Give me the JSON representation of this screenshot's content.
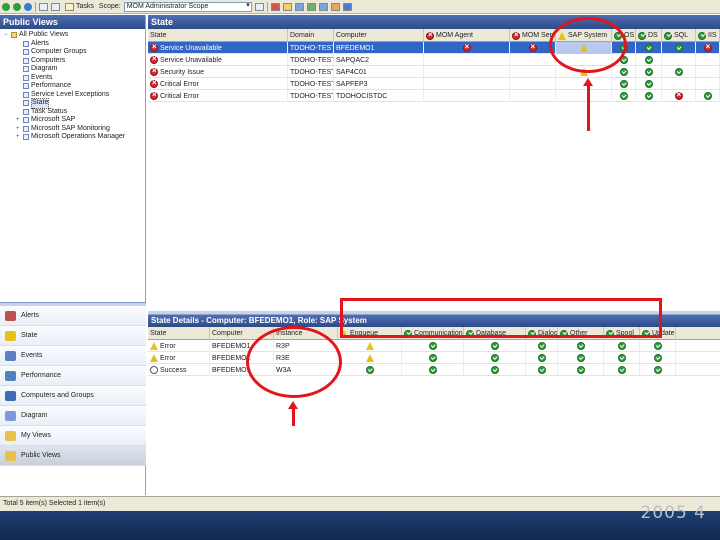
{
  "toolbar": {
    "tasks_label": "Tasks",
    "scope_label": "Scope:",
    "scope_value": "MOM Administrator Scope"
  },
  "left_pane": {
    "title": "Public Views",
    "tree": [
      {
        "label": "All Public Views",
        "depth": 0,
        "exp": "−"
      },
      {
        "label": "Alerts",
        "depth": 1,
        "exp": ""
      },
      {
        "label": "Computer Groups",
        "depth": 1,
        "exp": ""
      },
      {
        "label": "Computers",
        "depth": 1,
        "exp": ""
      },
      {
        "label": "Diagram",
        "depth": 1,
        "exp": ""
      },
      {
        "label": "Events",
        "depth": 1,
        "exp": ""
      },
      {
        "label": "Performance",
        "depth": 1,
        "exp": ""
      },
      {
        "label": "Service Level Exceptions",
        "depth": 1,
        "exp": ""
      },
      {
        "label": "State",
        "depth": 1,
        "exp": "",
        "selected": true
      },
      {
        "label": "Task Status",
        "depth": 1,
        "exp": ""
      },
      {
        "label": "Microsoft SAP",
        "depth": 1,
        "exp": "+"
      },
      {
        "label": "Microsoft SAP Monitoring",
        "depth": 1,
        "exp": "+"
      },
      {
        "label": "Microsoft Operations Manager",
        "depth": 1,
        "exp": "+"
      }
    ],
    "wunderbar": [
      {
        "label": "Alerts",
        "color": "#c0504d"
      },
      {
        "label": "State",
        "color": "#e6c217"
      },
      {
        "label": "Events",
        "color": "#5b7fc7"
      },
      {
        "label": "Performance",
        "color": "#4f81bd"
      },
      {
        "label": "Computers and Groups",
        "color": "#3c6cb4"
      },
      {
        "label": "Diagram",
        "color": "#7a9bd6"
      },
      {
        "label": "My Views",
        "color": "#e8c14b"
      },
      {
        "label": "Public Views",
        "color": "#e8c14b",
        "active": true
      }
    ]
  },
  "state_view": {
    "title": "State",
    "columns": [
      "State",
      "Domain",
      "Computer",
      "MOM Agent",
      "MOM Server",
      "SAP System",
      "OS",
      "DS",
      "SQL",
      "IIS"
    ],
    "rows": [
      {
        "state_icon": "crit",
        "state": "Service Unavailable",
        "domain": "TDOHO-TEST",
        "computer": "BFEDEMO1",
        "cells": [
          "crit",
          "crit",
          "warn",
          "ok",
          "ok",
          "ok",
          "crit"
        ],
        "selected": true
      },
      {
        "state_icon": "crit",
        "state": "Service Unavailable",
        "domain": "TDOHO-TEST",
        "computer": "SAPQAC2",
        "cells": [
          "",
          "",
          "",
          "ok",
          "ok",
          "",
          ""
        ]
      },
      {
        "state_icon": "crit",
        "state": "Security Issue",
        "domain": "TDOHO-TEST",
        "computer": "SAP4C01",
        "cells": [
          "",
          "",
          "warn",
          "ok",
          "ok",
          "ok",
          ""
        ]
      },
      {
        "state_icon": "crit",
        "state": "Critical Error",
        "domain": "TDOHO-TEST",
        "computer": "SAPFEP3",
        "cells": [
          "",
          "",
          "",
          "ok",
          "ok",
          "",
          ""
        ]
      },
      {
        "state_icon": "crit",
        "state": "Critical Error",
        "domain": "TDOHO-TEST",
        "computer": "TDOHOCISTDC",
        "cells": [
          "",
          "",
          "",
          "ok",
          "ok",
          "crit",
          "ok"
        ]
      }
    ]
  },
  "details": {
    "title": "State Details - Computer: BFEDEMO1, Role: SAP System",
    "columns": [
      "State",
      "Computer",
      "Instance",
      "Enqueue",
      "Communication",
      "Database",
      "Dialog",
      "Other",
      "Spool",
      "Update"
    ],
    "rows": [
      {
        "state_icon": "warn",
        "state": "Error",
        "computer": "BFEDEMO1",
        "instance": "R3P",
        "cells": [
          "warn",
          "ok",
          "ok",
          "ok",
          "ok",
          "ok",
          "ok"
        ]
      },
      {
        "state_icon": "warn",
        "state": "Error",
        "computer": "BFEDEMO1",
        "instance": "R3E",
        "cells": [
          "warn",
          "ok",
          "ok",
          "ok",
          "ok",
          "ok",
          "ok"
        ]
      },
      {
        "state_icon": "info",
        "state": "Success",
        "computer": "BFEDEMO1",
        "instance": "W3A",
        "cells": [
          "ok",
          "ok",
          "ok",
          "ok",
          "ok",
          "ok",
          "ok"
        ]
      }
    ]
  },
  "statusbar": {
    "text": "Total 5 item(s) Selected 1 item(s)"
  },
  "watermark": "2005 4"
}
